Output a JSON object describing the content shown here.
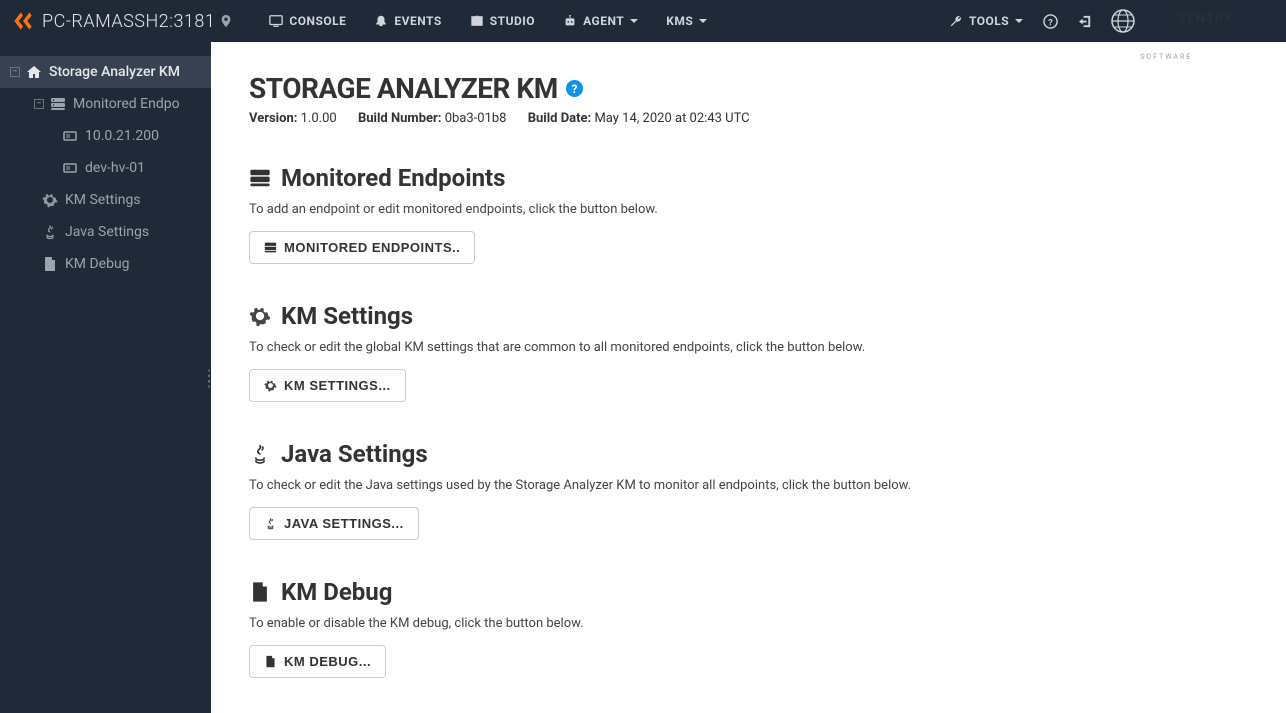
{
  "header": {
    "host": "PC-RAMASSH2:3181",
    "nav": {
      "console": "Console",
      "events": "Events",
      "studio": "Studio",
      "agent": "Agent",
      "kms": "KMs",
      "tools": "Tools"
    },
    "brand": {
      "name": "SENTRY",
      "sub": "SOFTWARE"
    }
  },
  "tree": {
    "root": "Storage Analyzer KM",
    "monitored": "Monitored Endpo",
    "endpoints": [
      "10.0.21.200",
      "dev-hv-01"
    ],
    "km_settings": "KM Settings",
    "java_settings": "Java Settings",
    "km_debug": "KM Debug"
  },
  "page": {
    "title": "STORAGE ANALYZER KM",
    "version_label": "Version:",
    "version": "1.0.00",
    "build_label": "Build Number:",
    "build": "0ba3-01b8",
    "date_label": "Build Date:",
    "date": "May 14, 2020 at 02:43 UTC"
  },
  "sections": {
    "endpoints": {
      "title": "Monitored Endpoints",
      "desc": "To add an endpoint or edit monitored endpoints, click the button below.",
      "button": "Monitored Endpoints.."
    },
    "km": {
      "title": "KM Settings",
      "desc": "To check or edit the global KM settings that are common to all monitored endpoints, click the button below.",
      "button": "KM Settings..."
    },
    "java": {
      "title": "Java Settings",
      "desc": "To check or edit the Java settings used by the Storage Analyzer KM to monitor all endpoints, click the button below.",
      "button": "Java Settings..."
    },
    "debug": {
      "title": "KM Debug",
      "desc": "To enable or disable the KM debug, click the button below.",
      "button": "KM Debug..."
    }
  }
}
